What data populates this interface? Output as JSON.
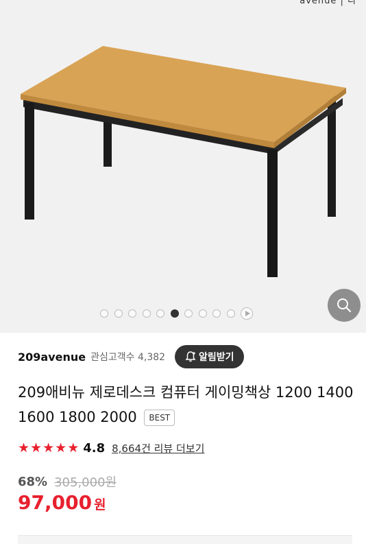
{
  "hero": {
    "brand_tag": "avenue | 디",
    "image_desc": "desk-product-image",
    "carousel": {
      "total": 10,
      "active_index": 5
    }
  },
  "seller": {
    "name": "209avenue",
    "followers": "관심고객수 4,382",
    "alarm_label": "알림받기"
  },
  "product": {
    "title": "209애비뉴 제로데스크 컴퓨터 게이밍책상 1200 1400 1600 1800 2000",
    "badge": "BEST"
  },
  "rating": {
    "stars": 5,
    "score": "4.8",
    "review_link": "8,664건 리뷰 더보기"
  },
  "price": {
    "discount": "68%",
    "original": "305,000원",
    "final": "97,000",
    "currency": "원"
  },
  "colors": {
    "accent": "#e8202e",
    "dark_button": "#333333"
  }
}
